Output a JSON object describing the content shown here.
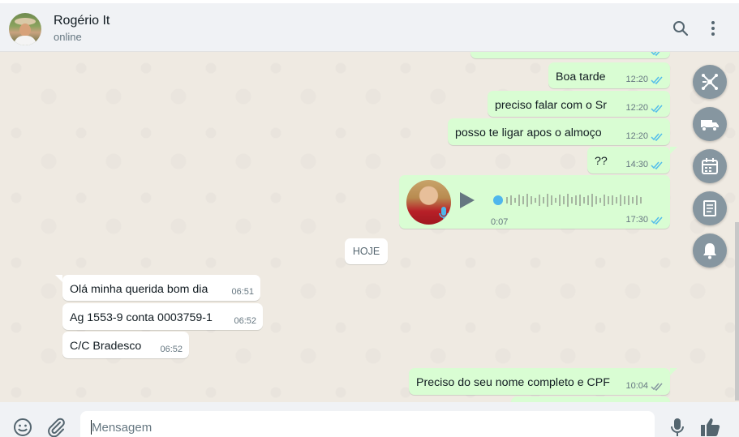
{
  "contact": {
    "name": "Rogério It",
    "status": "online"
  },
  "messages": [
    {
      "text": "Boa tarde",
      "time": "12:20"
    },
    {
      "text": "preciso falar com o Sr",
      "time": "12:20"
    },
    {
      "text": "posso te  ligar apos o almoço",
      "time": "12:20"
    },
    {
      "text": "??",
      "time": "14:30"
    },
    {
      "duration": "0:07",
      "time": "17:30"
    },
    {
      "text": "Olá minha querida bom dia",
      "time": "06:51"
    },
    {
      "text": "Ag 1553-9 conta 0003759-1",
      "time": "06:52"
    },
    {
      "text": "C/C Bradesco",
      "time": "06:52"
    },
    {
      "text": "Preciso do seu nome completo e CPF",
      "time": "10:04"
    }
  ],
  "day_separator": "HOJE",
  "composer": {
    "placeholder": "Mensagem"
  },
  "icons": {
    "search": "search-icon",
    "menu": "kebab-menu-icon",
    "emoji": "emoji-icon",
    "attach": "paperclip-icon",
    "mic": "microphone-icon",
    "like": "thumbs-up-icon",
    "play": "play-icon",
    "side": [
      "network-icon",
      "delivery-truck-icon",
      "calendar-icon",
      "document-icon",
      "bell-icon"
    ]
  },
  "colors": {
    "outgoing_bubble": "#d9fdd3",
    "incoming_bubble": "#ffffff",
    "read_ticks": "#53bdeb",
    "side_button": "#8696a0",
    "chat_bg": "#efeae2"
  }
}
